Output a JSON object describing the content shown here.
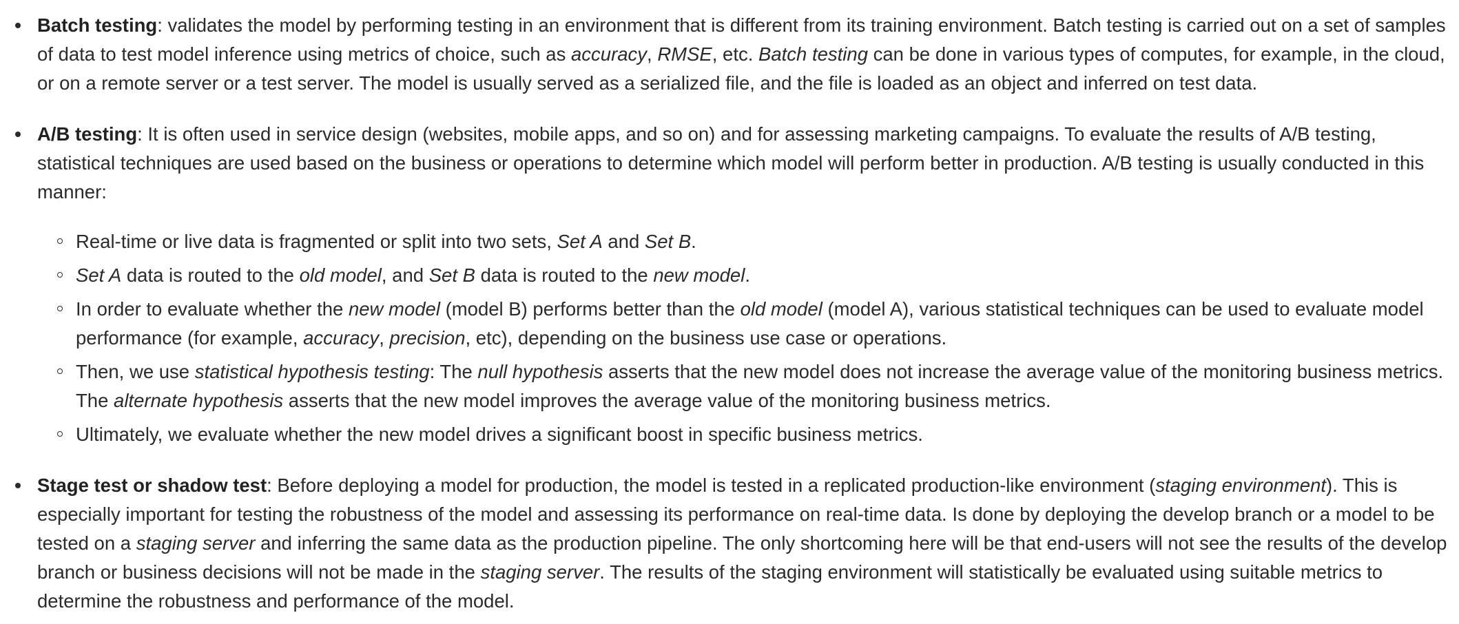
{
  "items": [
    {
      "term": "Batch testing",
      "segments": [
        {
          "t": ": validates the model by performing testing in an environment that is different from its training environment. Batch testing is carried out on a set of samples of data to test model inference using metrics of choice, such as "
        },
        {
          "t": "accuracy",
          "i": true
        },
        {
          "t": ", "
        },
        {
          "t": "RMSE",
          "i": true
        },
        {
          "t": ", etc. "
        },
        {
          "t": "Batch testing",
          "i": true
        },
        {
          "t": " can be done in various types of computes, for example, in the cloud, or on a remote server or a test server. The model is usually served as a serialized file, and the file is loaded as an object and inferred on test data."
        }
      ]
    },
    {
      "term": "A/B testing",
      "segments": [
        {
          "t": ": It is often used in service design (websites, mobile apps, and so on) and for assessing marketing campaigns. To evaluate the results of A/B testing, statistical techniques are used based on the business or operations to determine which model will perform better in production. A/B testing is usually conducted in this manner:"
        }
      ],
      "sub": [
        [
          {
            "t": "Real-time or live data is fragmented or split into two sets, "
          },
          {
            "t": "Set A",
            "i": true
          },
          {
            "t": " and "
          },
          {
            "t": "Set B",
            "i": true
          },
          {
            "t": "."
          }
        ],
        [
          {
            "t": "Set A",
            "i": true
          },
          {
            "t": " data is routed to the "
          },
          {
            "t": "old model",
            "i": true
          },
          {
            "t": ", and "
          },
          {
            "t": "Set B",
            "i": true
          },
          {
            "t": " data is routed to the "
          },
          {
            "t": "new model",
            "i": true
          },
          {
            "t": "."
          }
        ],
        [
          {
            "t": "In order to evaluate whether the "
          },
          {
            "t": "new model",
            "i": true
          },
          {
            "t": " (model B) performs better than the "
          },
          {
            "t": "old model",
            "i": true
          },
          {
            "t": " (model A), various statistical techniques can be used to evaluate model performance (for example, "
          },
          {
            "t": "accuracy",
            "i": true
          },
          {
            "t": ", "
          },
          {
            "t": "precision",
            "i": true
          },
          {
            "t": ", etc), depending on the business use case or operations."
          }
        ],
        [
          {
            "t": "Then, we use "
          },
          {
            "t": "statistical hypothesis testing",
            "i": true
          },
          {
            "t": ": The "
          },
          {
            "t": "null hypothesis",
            "i": true
          },
          {
            "t": " asserts that the new model does not increase the average value of the monitoring business metrics. The "
          },
          {
            "t": "alternate hypothesis",
            "i": true
          },
          {
            "t": " asserts that the new model improves the average value of the monitoring business metrics."
          }
        ],
        [
          {
            "t": "Ultimately, we evaluate whether the new model drives a significant boost in specific business metrics."
          }
        ]
      ]
    },
    {
      "term": "Stage test or shadow test",
      "segments": [
        {
          "t": ": Before deploying a model for production, the model is tested in a replicated production-like environment ("
        },
        {
          "t": "staging environment",
          "i": true
        },
        {
          "t": "). This is especially important for testing the robustness of the model and assessing its performance on real-time data. Is done by deploying the develop branch or a model to be tested on a "
        },
        {
          "t": "staging server",
          "i": true
        },
        {
          "t": " and inferring the same data as the production pipeline. The only shortcoming here will be that end-users will not see the results of the develop branch or business decisions will not be made in the "
        },
        {
          "t": "staging server",
          "i": true
        },
        {
          "t": ". The results of the staging environment will statistically be evaluated using suitable metrics to determine the robustness and performance of the model."
        }
      ]
    }
  ]
}
